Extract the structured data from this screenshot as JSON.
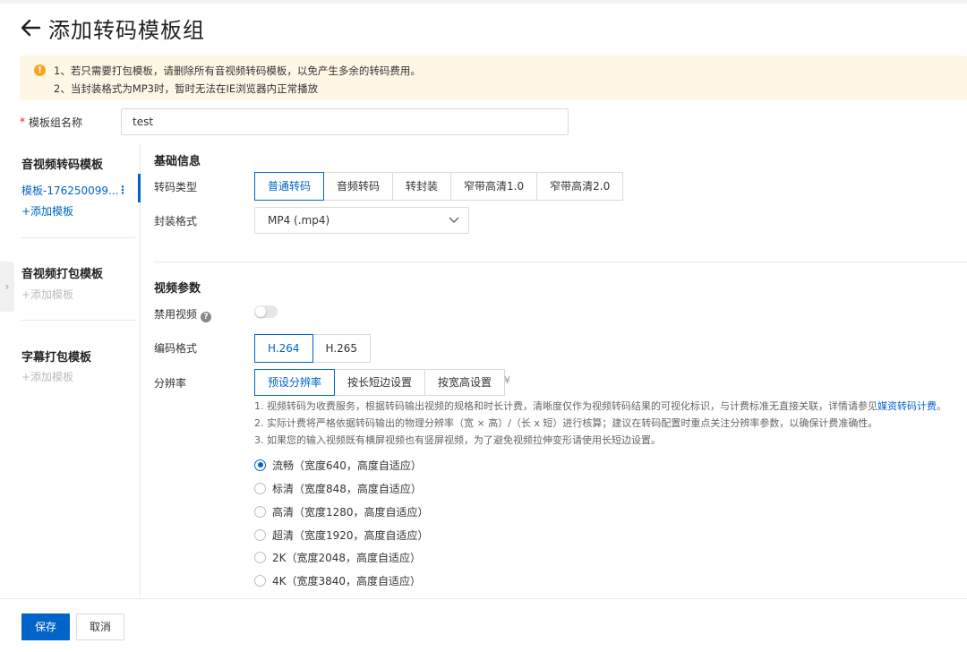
{
  "page": {
    "title": "添加转码模板组"
  },
  "notice": {
    "lines": [
      "1、若只需要打包模板，请删除所有音视频转码模板，以免产生多余的转码费用。",
      "2、当封装格式为MP3时，暂时无法在IE浏览器内正常播放"
    ]
  },
  "template_group_name": {
    "label": "模板组名称",
    "value": "test"
  },
  "sidebar": {
    "sections": [
      {
        "title": "音视频转码模板",
        "items": [
          "模板-176250099..."
        ],
        "add_label": "+添加模板"
      },
      {
        "title": "音视频打包模板",
        "items": [],
        "add_label": "+添加模板"
      },
      {
        "title": "字幕打包模板",
        "items": [],
        "add_label": "+添加模板"
      }
    ]
  },
  "basic_info": {
    "title": "基础信息",
    "transcode_type": {
      "label": "转码类型",
      "options": [
        "普通转码",
        "音频转码",
        "转封装",
        "窄带高清1.0",
        "窄带高清2.0"
      ],
      "selected": "普通转码"
    },
    "container_format": {
      "label": "封装格式",
      "value": "MP4 (.mp4)"
    }
  },
  "video_params": {
    "title": "视频参数",
    "disable_video": {
      "label": "禁用视频",
      "enabled": false
    },
    "codec": {
      "label": "编码格式",
      "options": [
        "H.264",
        "H.265"
      ],
      "selected": "H.264"
    },
    "resolution": {
      "label": "分辨率",
      "modes": [
        "预设分辨率",
        "按长短边设置",
        "按宽高设置"
      ],
      "selected_mode": "预设分辨率",
      "notes": {
        "n1_prefix": "1. 视频转码为收费服务，根据转码输出视频的规格和时长计费，清晰度仅作为视频转码结果的可视化标识，与计费标准无直接关联，详情请参见",
        "n1_link": "媒资转码计费",
        "n1_suffix": "。",
        "n2": "2. 实际计费将严格依据转码输出的物理分辨率（宽 × 高）/（长 x 短）进行核算；建议在转码配置时重点关注分辨率参数，以确保计费准确性。",
        "n3": "3. 如果您的输入视频既有横屏视频也有竖屏视频，为了避免视频拉伸变形请使用长短边设置。"
      },
      "presets": [
        {
          "label": "流畅（宽度640，高度自适应）",
          "checked": true
        },
        {
          "label": "标清（宽度848，高度自适应）",
          "checked": false
        },
        {
          "label": "高清（宽度1280，高度自适应）",
          "checked": false
        },
        {
          "label": "超清（宽度1920，高度自适应）",
          "checked": false
        },
        {
          "label": "2K（宽度2048，高度自适应）",
          "checked": false
        },
        {
          "label": "4K（宽度3840，高度自适应）",
          "checked": false
        }
      ]
    }
  },
  "footer": {
    "save_label": "保存",
    "cancel_label": "取消"
  },
  "colors": {
    "primary": "#0064c8",
    "warning_bg": "#fff7e6",
    "warning_icon": "#f5a623",
    "required": "#e02020"
  },
  "icons": {
    "back": "arrow-left-icon",
    "warning": "warning-icon",
    "more": "vertical-ellipsis-icon",
    "dropdown": "chevron-down-icon",
    "help": "question-icon",
    "expand": "double-chevron-down-icon",
    "collapse": "chevron-right-icon"
  }
}
